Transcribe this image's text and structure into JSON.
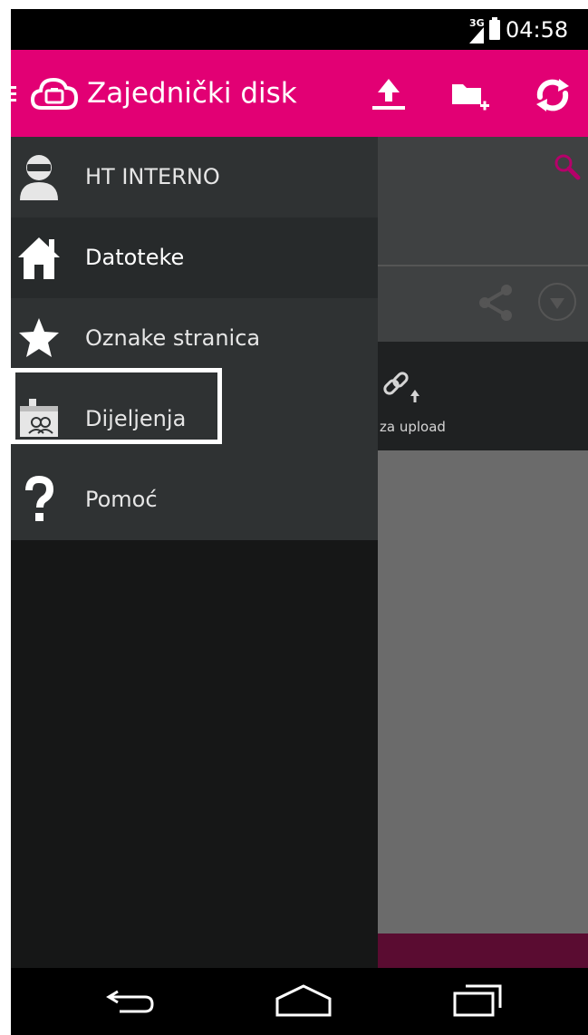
{
  "status_bar": {
    "network": "3G",
    "time": "04:58"
  },
  "app_bar": {
    "title": "Zajednički disk",
    "brand_color": "#e20074",
    "actions": [
      {
        "name": "upload-icon"
      },
      {
        "name": "new-folder-icon"
      },
      {
        "name": "refresh-icon"
      }
    ]
  },
  "drawer": {
    "items": [
      {
        "label": "HT INTERNO",
        "icon": "user-icon"
      },
      {
        "label": "Datoteke",
        "icon": "home-icon",
        "selected": true
      },
      {
        "label": "Oznake stranica",
        "icon": "star-icon"
      },
      {
        "label": "Dijeljenja",
        "icon": "shared-folder-icon",
        "highlighted": true
      },
      {
        "label": "Pomoć",
        "icon": "help-icon"
      }
    ]
  },
  "background": {
    "upload_link_label": "za upload"
  },
  "nav_bar": {
    "buttons": [
      "back-icon",
      "home-nav-icon",
      "recents-icon"
    ]
  }
}
